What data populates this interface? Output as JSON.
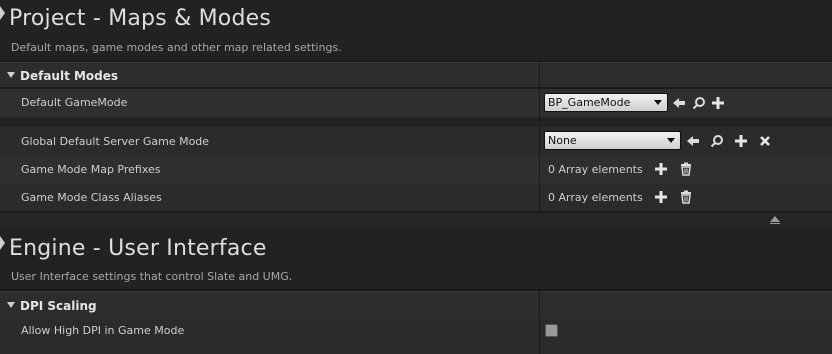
{
  "sections": [
    {
      "title": "Project - Maps & Modes",
      "description": "Default maps, game modes and other map related settings.",
      "categories": [
        {
          "label": "Default Modes",
          "properties": [
            {
              "label": "Default GameMode",
              "value": "BP_GameMode"
            },
            {
              "label": "Global Default Server Game Mode",
              "value": "None"
            },
            {
              "label": "Game Mode Map Prefixes",
              "value": "0 Array elements"
            },
            {
              "label": "Game Mode Class Aliases",
              "value": "0 Array elements"
            }
          ]
        }
      ]
    },
    {
      "title": "Engine - User Interface",
      "description": "User Interface settings that control Slate and UMG.",
      "categories": [
        {
          "label": "DPI Scaling",
          "properties": [
            {
              "label": "Allow High DPI in Game Mode",
              "checked": false
            }
          ]
        }
      ]
    }
  ],
  "icons": {
    "use": "arrow-left-icon",
    "browse": "magnifier-icon",
    "add": "plus-icon",
    "clear": "x-icon",
    "delete": "trash-icon"
  }
}
